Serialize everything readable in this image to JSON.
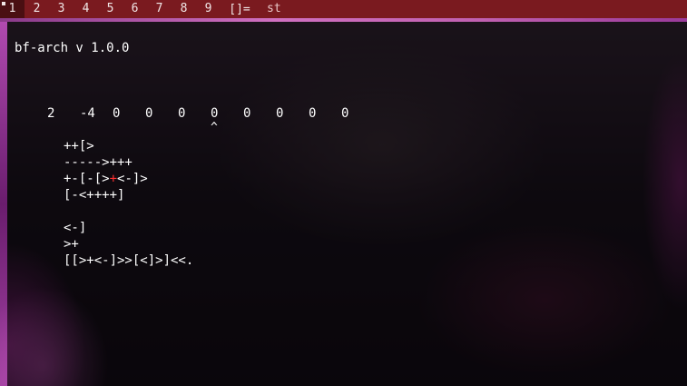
{
  "bar": {
    "tags": [
      "1",
      "2",
      "3",
      "4",
      "5",
      "6",
      "7",
      "8",
      "9"
    ],
    "active_tag": "1",
    "layout_symbol": "[]=",
    "window_title": "st"
  },
  "terminal": {
    "header": "bf-arch v 1.0.0",
    "memory_cells": [
      "2",
      "-4",
      "0",
      "0",
      "0",
      "0",
      "0",
      "0",
      "0",
      "0"
    ],
    "pointer_cell_index": 5,
    "pointer_symbol": "^",
    "code_lines": [
      "++[>",
      "----->+++",
      "+-[-[>+<-]>",
      "[-<++++]",
      "",
      "<-]",
      ">+",
      "[[>+<-]>>[<]>]<<."
    ],
    "code_cursor": {
      "line": 2,
      "before": "+-[-[>",
      "char": "+",
      "after": "<-]>"
    }
  },
  "colors": {
    "bar_bg": "#7a1a1f",
    "active_tag_bg": "#4a0f12",
    "border": "#d070c0",
    "text": "#ffffff",
    "cursor": "#ff3030"
  }
}
